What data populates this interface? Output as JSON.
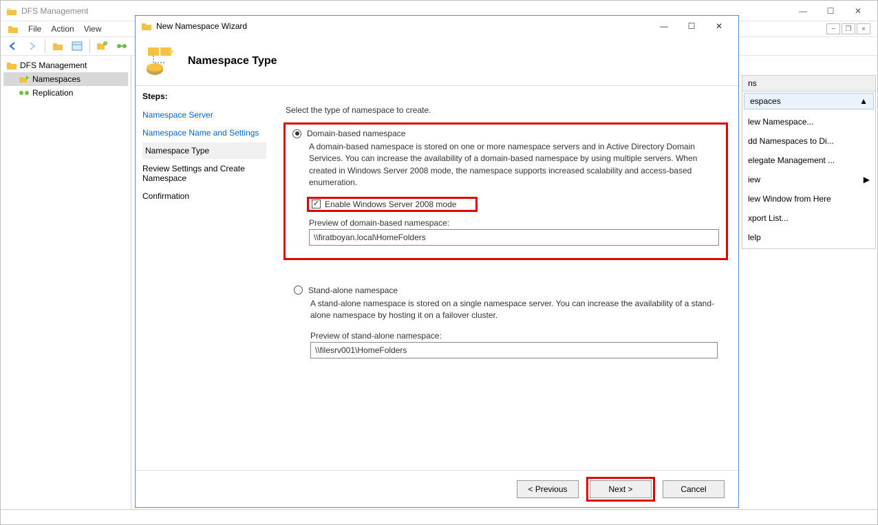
{
  "main": {
    "title": "DFS Management",
    "menu": {
      "file": "File",
      "action": "Action",
      "view": "View"
    },
    "tree": {
      "root": "DFS Management",
      "namespaces": "Namespaces",
      "replication": "Replication"
    },
    "actions": {
      "header": "ns",
      "sub": "espaces",
      "items": [
        "lew Namespace...",
        "dd Namespaces to Di...",
        "elegate Management ...",
        "iew",
        "lew Window from Here",
        "xport List...",
        "lelp"
      ]
    }
  },
  "wizard": {
    "title": "New Namespace Wizard",
    "heading": "Namespace Type",
    "steps_label": "Steps:",
    "steps": {
      "server": "Namespace Server",
      "name": "Namespace Name and Settings",
      "type": "Namespace Type",
      "review": "Review Settings and Create Namespace",
      "confirm": "Confirmation"
    },
    "content": {
      "intro": "Select the type of namespace to create.",
      "domain_label": "Domain-based namespace",
      "domain_desc": "A domain-based namespace is stored on one or more namespace servers and in Active Directory Domain Services. You can increase the availability of a domain-based namespace by using multiple servers. When created in Windows Server 2008 mode, the namespace supports increased scalability and access-based enumeration.",
      "enable_2008": "Enable Windows Server 2008 mode",
      "preview_domain_label": "Preview of domain-based namespace:",
      "preview_domain_value": "\\\\firatboyan.local\\HomeFolders",
      "standalone_label": "Stand-alone namespace",
      "standalone_desc": "A stand-alone namespace is stored on a single namespace server. You can increase the availability of a stand-alone namespace by hosting it on a failover cluster.",
      "preview_sa_label": "Preview of stand-alone namespace:",
      "preview_sa_value": "\\\\filesrv001\\HomeFolders"
    },
    "buttons": {
      "prev": "< Previous",
      "next": "Next >",
      "cancel": "Cancel"
    }
  }
}
